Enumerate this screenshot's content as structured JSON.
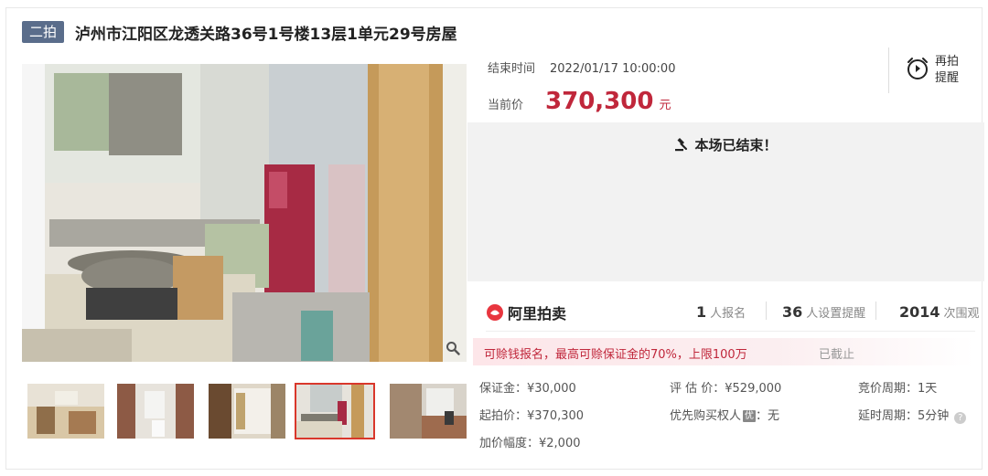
{
  "header": {
    "badge": "二拍",
    "title": "泸州市江阳区龙透关路36号1号楼13层1单元29号房屋"
  },
  "auction": {
    "end_time_label": "结束时间",
    "end_time_value": "2022/01/17 10:00:00",
    "price_label": "当前价",
    "price_value": "370,300",
    "price_unit": "元",
    "remind_label_line1": "再拍",
    "remind_label_line2": "提醒",
    "ended_message": "本场已结束！"
  },
  "stats": {
    "brand": "阿里拍卖",
    "signups_value": "1",
    "signups_label": "人报名",
    "reminders_value": "36",
    "reminders_label": "人设置提醒",
    "views_value": "2014",
    "views_label": "次围观"
  },
  "promo": {
    "text": "可赊钱报名，最高可赊保证金的70%，上限100万",
    "status": "已截止"
  },
  "details": {
    "deposit": "保证金：¥30,000",
    "start_price": "起拍价：¥370,300",
    "increment": "加价幅度：¥2,000",
    "appraisal": "评 估 价：¥529,000",
    "priority_buyer_label": "优先购买权人",
    "priority_buyer_badge": "优",
    "priority_buyer_value": "：无",
    "bid_period": "竞价周期：1天",
    "delay_period": "延时周期：5分钟"
  },
  "thumbnails": [
    {
      "name": "thumb-1"
    },
    {
      "name": "thumb-2"
    },
    {
      "name": "thumb-3"
    },
    {
      "name": "thumb-4",
      "active": true
    },
    {
      "name": "thumb-5"
    }
  ],
  "colors": {
    "price": "#c0273b",
    "badge_bg": "#5a6d8b",
    "active_thumb_border": "#d9372b"
  }
}
